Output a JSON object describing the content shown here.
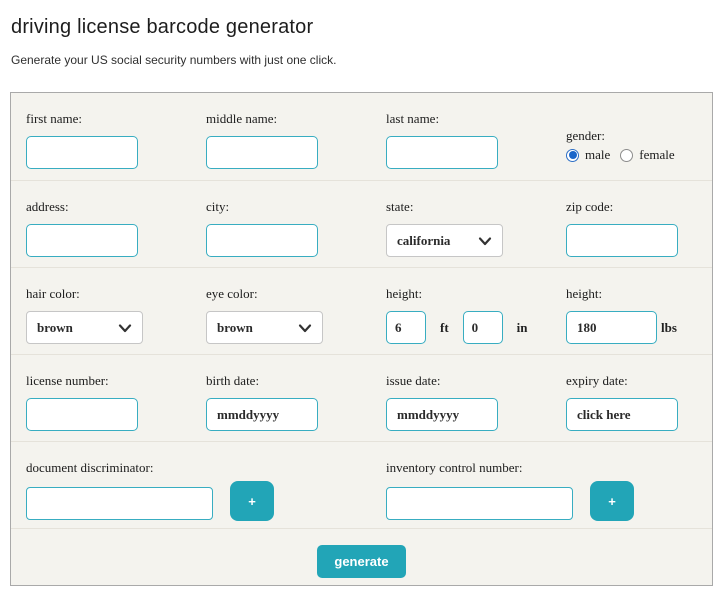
{
  "page": {
    "title": "driving license barcode generator",
    "subtitle": "Generate your US social security numbers with just one click."
  },
  "colors": {
    "accent_teal": "#22a5b7",
    "input_border_teal": "#38adc1",
    "panel_background": "#f4f3ee",
    "radio_selected_blue": "#1b66c9"
  },
  "form": {
    "first_name": {
      "label": "first name:",
      "value": ""
    },
    "middle_name": {
      "label": "middle name:",
      "value": ""
    },
    "last_name": {
      "label": "last name:",
      "value": ""
    },
    "gender": {
      "label": "gender:",
      "options": [
        {
          "label": "male",
          "selected": true
        },
        {
          "label": "female",
          "selected": false
        }
      ]
    },
    "address": {
      "label": "address:",
      "value": ""
    },
    "city": {
      "label": "city:",
      "value": ""
    },
    "state": {
      "label": "state:",
      "selected_option": "california"
    },
    "zip_code": {
      "label": "zip code:",
      "value": ""
    },
    "hair_color": {
      "label": "hair color:",
      "selected_option": "brown"
    },
    "eye_color": {
      "label": "eye color:",
      "selected_option": "brown"
    },
    "height_ft_in": {
      "label": "height:",
      "ft_value": "6",
      "ft_unit": "ft",
      "in_value": "0",
      "in_unit": "in"
    },
    "height_lbs": {
      "label": "height:",
      "value": "180",
      "unit": "lbs"
    },
    "license_number": {
      "label": "license number:",
      "value": ""
    },
    "birth_date": {
      "label": "birth date:",
      "value": "mmddyyyy"
    },
    "issue_date": {
      "label": "issue date:",
      "value": "mmddyyyy"
    },
    "expiry_date": {
      "label": "expiry date:",
      "value": "click here"
    },
    "document_discriminator": {
      "label": "document discriminator:",
      "value": "",
      "add_button_label": "+"
    },
    "inventory_control_number": {
      "label": "inventory control number:",
      "value": "",
      "add_button_label": "+"
    },
    "generate_button_label": "generate"
  }
}
